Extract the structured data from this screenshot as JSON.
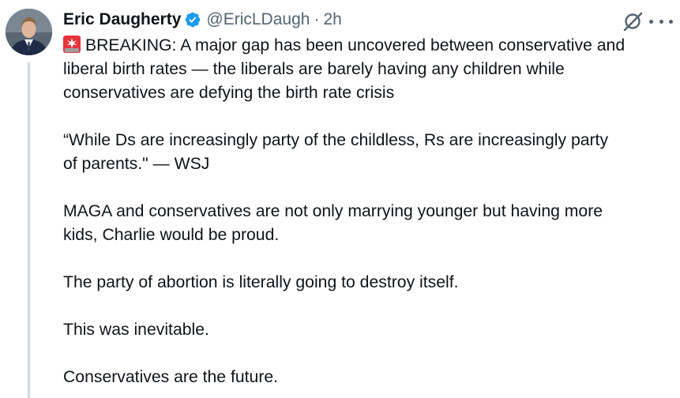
{
  "author": {
    "display_name": "Eric Daugherty",
    "handle": "@EricLDaugh",
    "separator": "·",
    "time": "2h"
  },
  "icons": {
    "avatar": "profile-photo",
    "verified": "verified-badge-icon",
    "grok": "grok-icon",
    "more": "more-options-icon",
    "breaking": "rotating-light-emoji"
  },
  "colors": {
    "verified": "#1d9bf0",
    "text": "#0f1419",
    "muted": "#536471",
    "thread_line": "#cfd9de",
    "emoji_red": "#e8333a"
  },
  "tweet": {
    "lines_1": [
      "BREAKING: A major gap has been uncovered between conservative and",
      "liberal birth rates — the liberals are barely having any children while",
      "conservatives are defying the birth rate crisis"
    ],
    "lines_2": [
      "“While Ds are increasingly party of the childless, Rs are increasingly party",
      "of parents.\" — WSJ"
    ],
    "lines_3": [
      "MAGA and conservatives are not only marrying younger but having more",
      "kids, Charlie would be proud."
    ],
    "paragraph_4": "The party of abortion is literally going to destroy itself.",
    "paragraph_5": "This was inevitable.",
    "paragraph_6": "Conservatives are the future."
  }
}
